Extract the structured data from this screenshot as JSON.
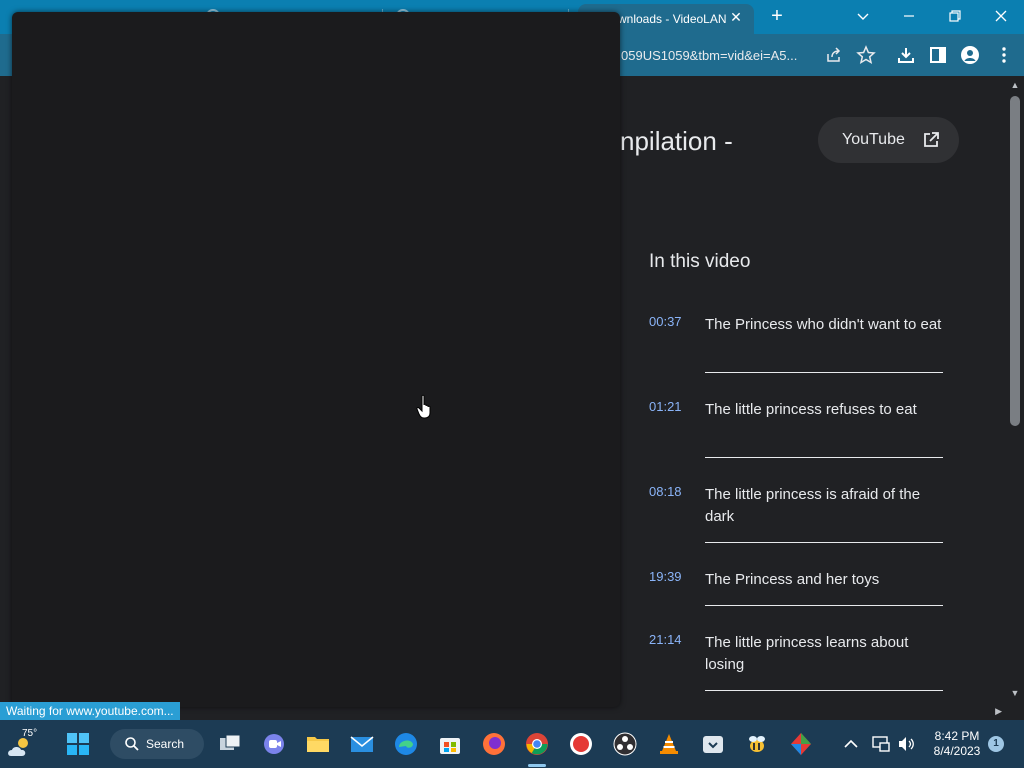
{
  "browser": {
    "active_tab_title": "wnloads - VideoLAN",
    "url_fragment": "059US1059&tbm=vid&ei=A5...",
    "status_text": "Waiting for www.youtube.com..."
  },
  "video_panel": {
    "title_fragment": "npilation -",
    "youtube_button_label": "YouTube",
    "section_heading": "In this video",
    "chapters": [
      {
        "time": "00:37",
        "title": "The Princess who didn't want to eat"
      },
      {
        "time": "01:21",
        "title": "The little princess refuses to eat"
      },
      {
        "time": "08:18",
        "title": "The little princess is afraid of the dark"
      },
      {
        "time": "19:39",
        "title": "The Princess and her toys"
      },
      {
        "time": "21:14",
        "title": "The little princess learns about losing"
      }
    ]
  },
  "taskbar": {
    "weather_temp": "75°",
    "search_label": "Search",
    "time": "8:42 PM",
    "date": "8/4/2023",
    "notification_count": "1",
    "apps": [
      "task-view",
      "teams",
      "file-explorer",
      "mail",
      "edge",
      "store",
      "firefox",
      "chrome",
      "record",
      "obs",
      "vlc",
      "app-tray",
      "bee",
      "kite"
    ]
  },
  "colors": {
    "tabstrip": "#0b7fb1",
    "toolbar": "#1f6b8e",
    "page_bg": "#202124",
    "overlay": "#1b1b1d",
    "chapter_time": "#8ab4f8",
    "taskbar": "#1c3b54"
  }
}
